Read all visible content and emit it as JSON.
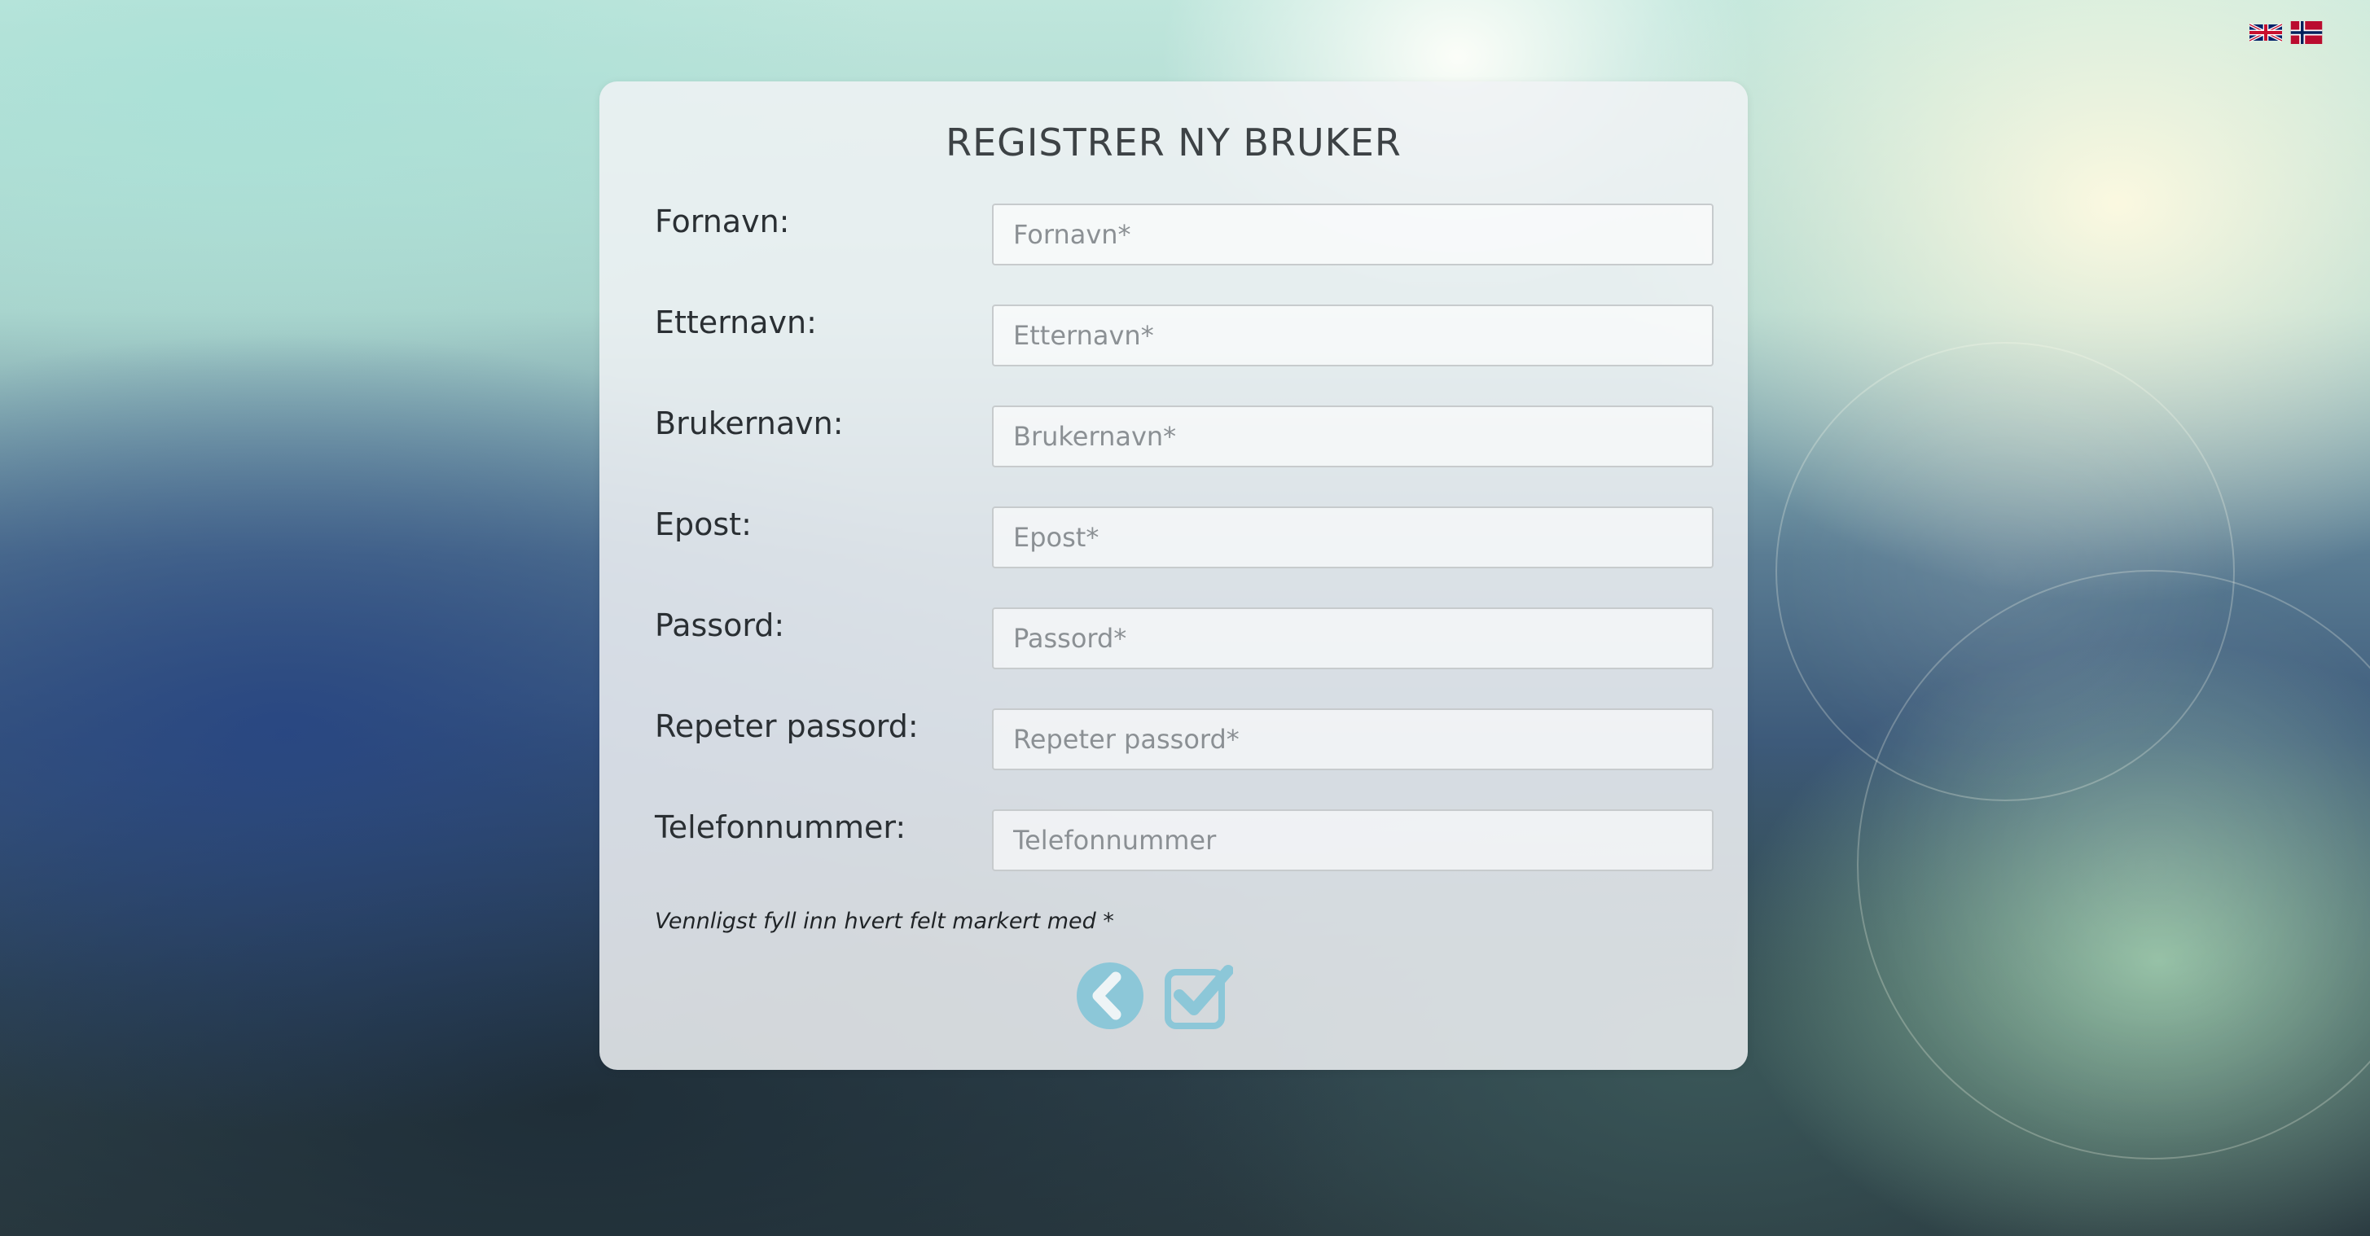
{
  "header": {
    "languages": [
      {
        "name": "English",
        "icon": "uk-flag-icon"
      },
      {
        "name": "Norsk",
        "icon": "norway-flag-icon"
      }
    ]
  },
  "form": {
    "title": "REGISTRER NY BRUKER",
    "fields": [
      {
        "label": "Fornavn:",
        "placeholder": "Fornavn*",
        "value": ""
      },
      {
        "label": "Etternavn:",
        "placeholder": "Etternavn*",
        "value": ""
      },
      {
        "label": "Brukernavn:",
        "placeholder": "Brukernavn*",
        "value": ""
      },
      {
        "label": "Epost:",
        "placeholder": "Epost*",
        "value": ""
      },
      {
        "label": "Passord:",
        "placeholder": "Passord*",
        "value": ""
      },
      {
        "label": "Repeter passord:",
        "placeholder": "Repeter passord*",
        "value": ""
      },
      {
        "label": "Telefonnummer:",
        "placeholder": "Telefonnummer",
        "value": ""
      }
    ],
    "note": "Vennligst fyll inn hvert felt markert med *",
    "buttons": {
      "back_icon": "chevron-left-circle-icon",
      "submit_icon": "checkbox-check-icon"
    }
  },
  "colors": {
    "button_accent": "#8cc7d8",
    "title_text": "#3d4245"
  }
}
